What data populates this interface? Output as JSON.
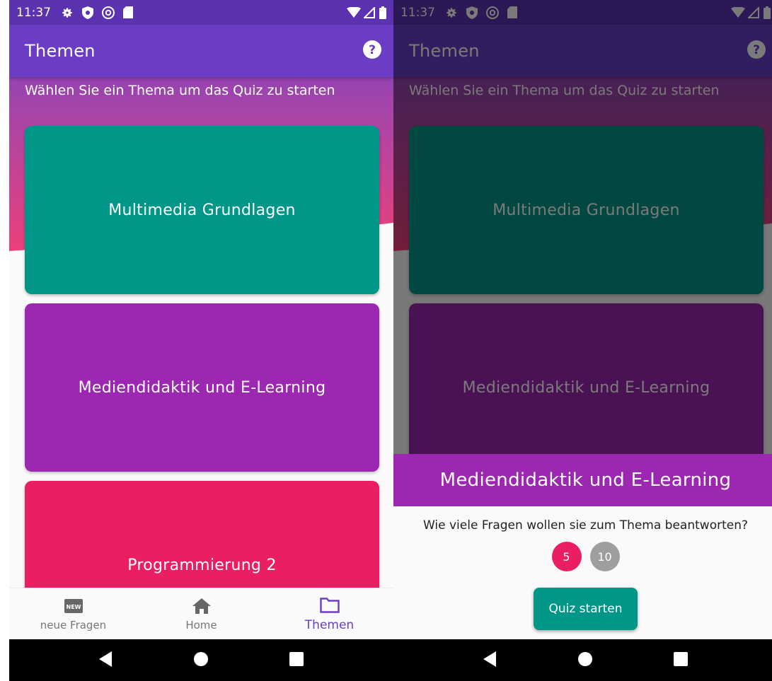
{
  "status_bar": {
    "time": "11:37"
  },
  "app_bar": {
    "title": "Themen"
  },
  "subtitle": "Wählen Sie ein Thema um das Quiz zu starten",
  "topics": [
    {
      "label": "Multimedia Grundlagen",
      "color": "#009688"
    },
    {
      "label": "Mediendidaktik und E-Learning",
      "color": "#9c27b0"
    },
    {
      "label": "Programmierung 2",
      "color": "#e91e63"
    }
  ],
  "bottom_nav": [
    {
      "label": "neue Fragen",
      "icon": "new-badge-icon",
      "active": false
    },
    {
      "label": "Home",
      "icon": "home-icon",
      "active": false
    },
    {
      "label": "Themen",
      "icon": "folder-icon",
      "active": true
    }
  ],
  "dialog": {
    "title": "Mediendidaktik und E-Learning",
    "question": "Wie viele Fragen wollen sie zum Thema beantworten?",
    "options": [
      "5",
      "10"
    ],
    "selected": "5",
    "start_label": "Quiz starten",
    "accent": "#9c27b0",
    "selected_color": "#e91e63",
    "button_color": "#009688"
  },
  "colors": {
    "primary": "#6a3dc4",
    "status_bar": "#5b32b0",
    "gradient_pink": "#ec407a"
  }
}
